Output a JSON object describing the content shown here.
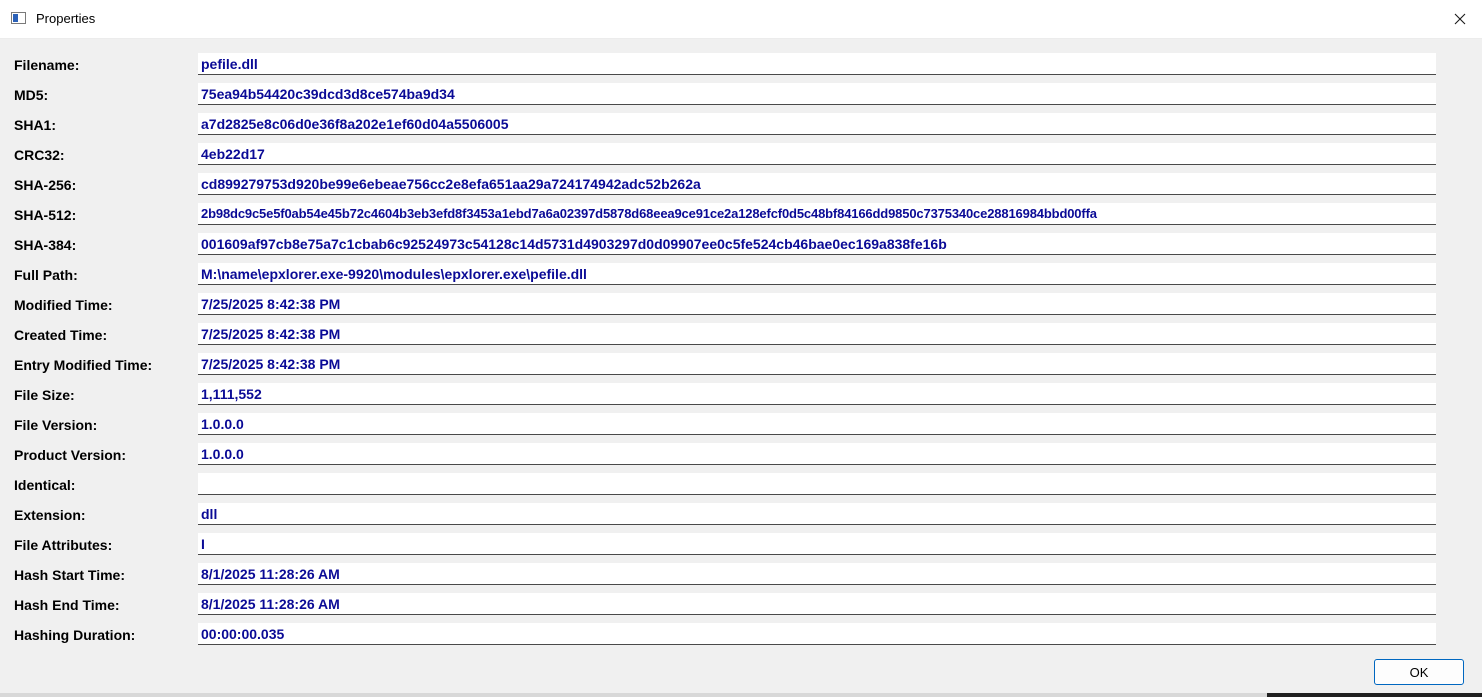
{
  "window": {
    "title": "Properties",
    "ok_label": "OK"
  },
  "fields": [
    {
      "label": "Filename:",
      "value": "pefile.dll"
    },
    {
      "label": "MD5:",
      "value": "75ea94b54420c39dcd3d8ce574ba9d34"
    },
    {
      "label": "SHA1:",
      "value": "a7d2825e8c06d0e36f8a202e1ef60d04a5506005"
    },
    {
      "label": "CRC32:",
      "value": "4eb22d17"
    },
    {
      "label": "SHA-256:",
      "value": "cd899279753d920be99e6ebeae756cc2e8efa651aa29a724174942adc52b262a"
    },
    {
      "label": "SHA-512:",
      "value": "2b98dc9c5e5f0ab54e45b72c4604b3eb3efd8f3453a1ebd7a6a02397d5878d68eea9ce91ce2a128efcf0d5c48bf84166dd9850c7375340ce28816984bbd00ffa"
    },
    {
      "label": "SHA-384:",
      "value": "001609af97cb8e75a7c1cbab6c92524973c54128c14d5731d4903297d0d09907ee0c5fe524cb46bae0ec169a838fe16b"
    },
    {
      "label": "Full Path:",
      "value": "M:\\name\\epxlorer.exe-9920\\modules\\epxlorer.exe\\pefile.dll"
    },
    {
      "label": "Modified Time:",
      "value": "7/25/2025 8:42:38 PM"
    },
    {
      "label": "Created Time:",
      "value": "7/25/2025 8:42:38 PM"
    },
    {
      "label": "Entry Modified Time:",
      "value": "7/25/2025 8:42:38 PM"
    },
    {
      "label": "File Size:",
      "value": "1,111,552"
    },
    {
      "label": "File Version:",
      "value": "1.0.0.0"
    },
    {
      "label": "Product Version:",
      "value": "1.0.0.0"
    },
    {
      "label": "Identical:",
      "value": ""
    },
    {
      "label": "Extension:",
      "value": "dll"
    },
    {
      "label": "File Attributes:",
      "value": "I"
    },
    {
      "label": "Hash Start Time:",
      "value": "8/1/2025 11:28:26 AM"
    },
    {
      "label": "Hash End Time:",
      "value": "8/1/2025 11:28:26 AM"
    },
    {
      "label": "Hashing Duration:",
      "value": "00:00:00.035"
    }
  ],
  "colors": {
    "value_text": "#0a0a96",
    "ok_border": "#0067c0"
  },
  "icons": {
    "app": "window-app-icon",
    "close": "close-icon"
  }
}
